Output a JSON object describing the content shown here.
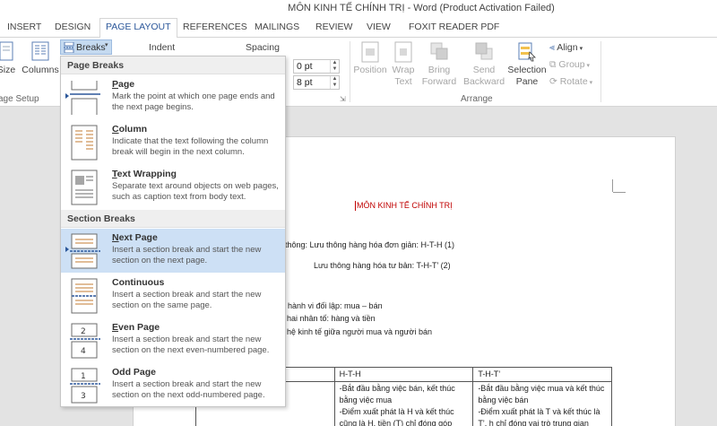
{
  "window": {
    "title": "MÔN KINH TẾ CHÍNH TRỊ - Word (Product Activation Failed)"
  },
  "tabs": [
    "INSERT",
    "DESIGN",
    "PAGE LAYOUT",
    "REFERENCES",
    "MAILINGS",
    "REVIEW",
    "VIEW",
    "FOXIT READER PDF"
  ],
  "active_tab": "PAGE LAYOUT",
  "ribbon": {
    "size_label": "Size",
    "columns_label": "Columns",
    "breaks_label": "Breaks",
    "page_setup_label": "age Setup",
    "indent_label": "Indent",
    "spacing_label": "Spacing",
    "spacing_before": "0 pt",
    "spacing_after": "8 pt",
    "position_label": "Position",
    "wrap_text_label": "Wrap Text",
    "bring_forward_label": "Bring Forward",
    "send_backward_label": "Send Backward",
    "selection_pane_label": "Selection Pane",
    "align_label": "Align",
    "group_label": "Group",
    "rotate_label": "Rotate",
    "arrange_label": "Arrange"
  },
  "breaks_menu": {
    "page_breaks_header": "Page Breaks",
    "section_breaks_header": "Section Breaks",
    "items": [
      {
        "name": "Page",
        "accel": "P",
        "rest": "age",
        "desc": "Mark the point at which one page ends and the next page begins."
      },
      {
        "name": "Column",
        "accel": "C",
        "rest": "olumn",
        "desc": "Indicate that the text following the column break will begin in the next column."
      },
      {
        "name": "Text Wrapping",
        "accel": "T",
        "rest": "ext Wrapping",
        "desc": "Separate text around objects on web pages, such as caption text from body text."
      },
      {
        "name": "Next Page",
        "accel": "N",
        "rest": "ext Page",
        "desc": "Insert a section break and start the new section on the next page."
      },
      {
        "name": "Continuous",
        "accel": "O",
        "rest": "Continuous",
        "desc": "Insert a section break and start the new section on the same page."
      },
      {
        "name": "Even Page",
        "accel": "E",
        "rest": "ven Page",
        "desc": "Insert a section break and start the new section on the next even-numbered page."
      },
      {
        "name": "Odd Page",
        "accel": "D",
        "rest": "Odd Page",
        "desc": "Insert a section break and start the new section on the next odd-numbered page."
      }
    ]
  },
  "document": {
    "title": "MÔN KINH TẾ CHÍNH TRỊ",
    "line1": "thông: Lưu thông hàng hóa đơn giản: H-T-H (1)",
    "line2": "Lưu thông hàng hóa tư bản: T-H-T’  (2)",
    "line3": "hành vi đối lập: mua – bán",
    "line4": "hai nhân tố: hàng và tiền",
    "line5": "hệ kinh tế giữa người mua và người bán",
    "table_headers": [
      "",
      "H-T-H",
      "T-H-T’"
    ],
    "table_col1": [
      "-Bắt đầu bằng việc bán, kết thúc bằng việc mua",
      "-Điểm xuất phát là H và kết thúc cũng là H, tiền (T) chỉ đóng góp"
    ],
    "table_col2": [
      "-Bắt đầu bằng việc mua và kết thúc bằng việc bán",
      "-Điểm xuất phát là T và kết thúc là T’, h chỉ đóng vai trò trung gian"
    ]
  },
  "colors": {
    "accent": "#2b579a",
    "hover": "#cde0f5",
    "title_red": "#c00000"
  }
}
